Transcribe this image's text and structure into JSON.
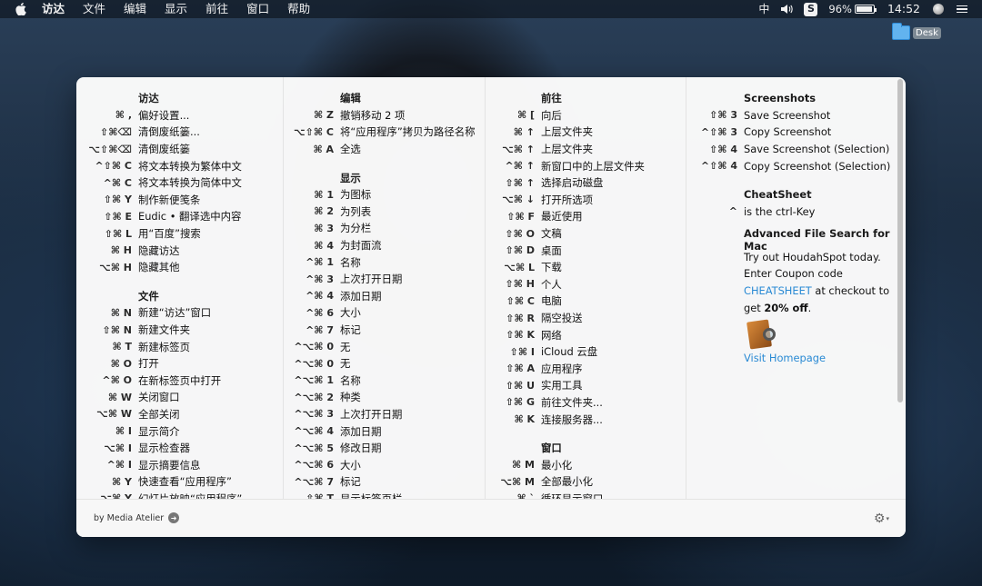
{
  "menubar": {
    "app": "访达",
    "items": [
      "文件",
      "编辑",
      "显示",
      "前往",
      "窗口",
      "帮助"
    ],
    "ime": "中",
    "battery": "96%",
    "battery_level": 0.96,
    "time": "14:52"
  },
  "desktop": {
    "label": "Desk"
  },
  "columns": [
    {
      "sections": [
        {
          "title": "访达",
          "rows": [
            {
              "key": "⌘ ,",
              "label": "偏好设置..."
            },
            {
              "key": "⇧⌘⌫",
              "label": "清倒废纸篓..."
            },
            {
              "key": "⌥⇧⌘⌫",
              "label": "清倒废纸篓"
            },
            {
              "key": "^⇧⌘ C",
              "label": "将文本转换为繁体中文"
            },
            {
              "key": "^⌘ C",
              "label": "将文本转换为简体中文"
            },
            {
              "key": "⇧⌘ Y",
              "label": "制作新便笺条"
            },
            {
              "key": "⇧⌘ E",
              "label": "Eudic • 翻译选中内容"
            },
            {
              "key": "⇧⌘ L",
              "label": "用“百度”搜索"
            },
            {
              "key": "⌘ H",
              "label": "隐藏访达"
            },
            {
              "key": "⌥⌘ H",
              "label": "隐藏其他"
            }
          ]
        },
        {
          "title": "文件",
          "rows": [
            {
              "key": "⌘ N",
              "label": "新建“访达”窗口"
            },
            {
              "key": "⇧⌘ N",
              "label": "新建文件夹"
            },
            {
              "key": "⌘ T",
              "label": "新建标签页"
            },
            {
              "key": "⌘ O",
              "label": "打开"
            },
            {
              "key": "^⌘ O",
              "label": "在新标签页中打开"
            },
            {
              "key": "⌘ W",
              "label": "关闭窗口"
            },
            {
              "key": "⌥⌘ W",
              "label": "全部关闭"
            },
            {
              "key": "⌘ I",
              "label": "显示简介"
            },
            {
              "key": "⌥⌘ I",
              "label": "显示检查器"
            },
            {
              "key": "^⌘ I",
              "label": "显示摘要信息"
            },
            {
              "key": "⌘ Y",
              "label": "快速查看“应用程序”"
            },
            {
              "key": "⌥⌘ Y",
              "label": "幻灯片放映“应用程序”"
            }
          ]
        }
      ]
    },
    {
      "sections": [
        {
          "title": "编辑",
          "rows": [
            {
              "key": "⌘ Z",
              "label": "撤销移动 2 项"
            },
            {
              "key": "⌥⇧⌘ C",
              "label": "将“应用程序”拷贝为路径名称"
            },
            {
              "key": "⌘ A",
              "label": "全选"
            }
          ]
        },
        {
          "title": "显示",
          "rows": [
            {
              "key": "⌘ 1",
              "label": "为图标"
            },
            {
              "key": "⌘ 2",
              "label": "为列表"
            },
            {
              "key": "⌘ 3",
              "label": "为分栏"
            },
            {
              "key": "⌘ 4",
              "label": "为封面流"
            },
            {
              "key": "^⌘ 1",
              "label": "名称"
            },
            {
              "key": "^⌘ 3",
              "label": "上次打开日期"
            },
            {
              "key": "^⌘ 4",
              "label": "添加日期"
            },
            {
              "key": "^⌘ 6",
              "label": "大小"
            },
            {
              "key": "^⌘ 7",
              "label": "标记"
            },
            {
              "key": "^⌥⌘ 0",
              "label": "无"
            },
            {
              "key": "^⌥⌘ 0",
              "label": "无"
            },
            {
              "key": "^⌥⌘ 1",
              "label": "名称"
            },
            {
              "key": "^⌥⌘ 2",
              "label": "种类"
            },
            {
              "key": "^⌥⌘ 3",
              "label": "上次打开日期"
            },
            {
              "key": "^⌥⌘ 4",
              "label": "添加日期"
            },
            {
              "key": "^⌥⌘ 5",
              "label": "修改日期"
            },
            {
              "key": "^⌥⌘ 6",
              "label": "大小"
            },
            {
              "key": "^⌥⌘ 7",
              "label": "标记"
            },
            {
              "key": "⇧⌘ T",
              "label": "显示标签页栏"
            }
          ]
        }
      ]
    },
    {
      "sections": [
        {
          "title": "前往",
          "rows": [
            {
              "key": "⌘ [",
              "label": "向后"
            },
            {
              "key": "⌘ ↑",
              "label": "上层文件夹"
            },
            {
              "key": "⌥⌘ ↑",
              "label": "上层文件夹"
            },
            {
              "key": "^⌘ ↑",
              "label": "新窗口中的上层文件夹"
            },
            {
              "key": "⇧⌘ ↑",
              "label": "选择启动磁盘"
            },
            {
              "key": "⌥⌘ ↓",
              "label": "打开所选项"
            },
            {
              "key": "⇧⌘ F",
              "label": "最近使用"
            },
            {
              "key": "⇧⌘ O",
              "label": "文稿"
            },
            {
              "key": "⇧⌘ D",
              "label": "桌面"
            },
            {
              "key": "⌥⌘ L",
              "label": "下载"
            },
            {
              "key": "⇧⌘ H",
              "label": "个人"
            },
            {
              "key": "⇧⌘ C",
              "label": "电脑"
            },
            {
              "key": "⇧⌘ R",
              "label": "隔空投送"
            },
            {
              "key": "⇧⌘ K",
              "label": "网络"
            },
            {
              "key": "⇧⌘ I",
              "label": "iCloud 云盘"
            },
            {
              "key": "⇧⌘ A",
              "label": "应用程序"
            },
            {
              "key": "⇧⌘ U",
              "label": "实用工具"
            },
            {
              "key": "⇧⌘ G",
              "label": "前往文件夹..."
            },
            {
              "key": "⌘ K",
              "label": "连接服务器..."
            }
          ]
        },
        {
          "title": "窗口",
          "rows": [
            {
              "key": "⌘ M",
              "label": "最小化"
            },
            {
              "key": "⌥⌘ M",
              "label": "全部最小化"
            },
            {
              "key": "⌘ `",
              "label": "循环显示窗口"
            }
          ]
        }
      ]
    }
  ],
  "screenshots": {
    "title": "Screenshots",
    "rows": [
      {
        "key": "⇧⌘ 3",
        "label": "Save Screenshot"
      },
      {
        "key": "^⇧⌘ 3",
        "label": "Copy Screenshot"
      },
      {
        "key": "⇧⌘ 4",
        "label": "Save Screenshot (Selection)"
      },
      {
        "key": "^⇧⌘ 4",
        "label": "Copy Screenshot (Selection)"
      }
    ]
  },
  "cheatsheet": {
    "title": "CheatSheet",
    "key": "^",
    "label": "is the ctrl-Key"
  },
  "promo": {
    "title": "Advanced File Search for Mac",
    "line1": "Try out HoudahSpot today.",
    "line2": "Enter Coupon code",
    "coupon": "CHEATSHEET",
    "line3_rest": " at checkout to",
    "line4_pre": "get ",
    "line4_bold": "20% off",
    "line4_post": ".",
    "visit": "Visit Homepage"
  },
  "footer": {
    "byline": "by Media Atelier"
  },
  "colors": {
    "link": "#2a8ad4"
  }
}
